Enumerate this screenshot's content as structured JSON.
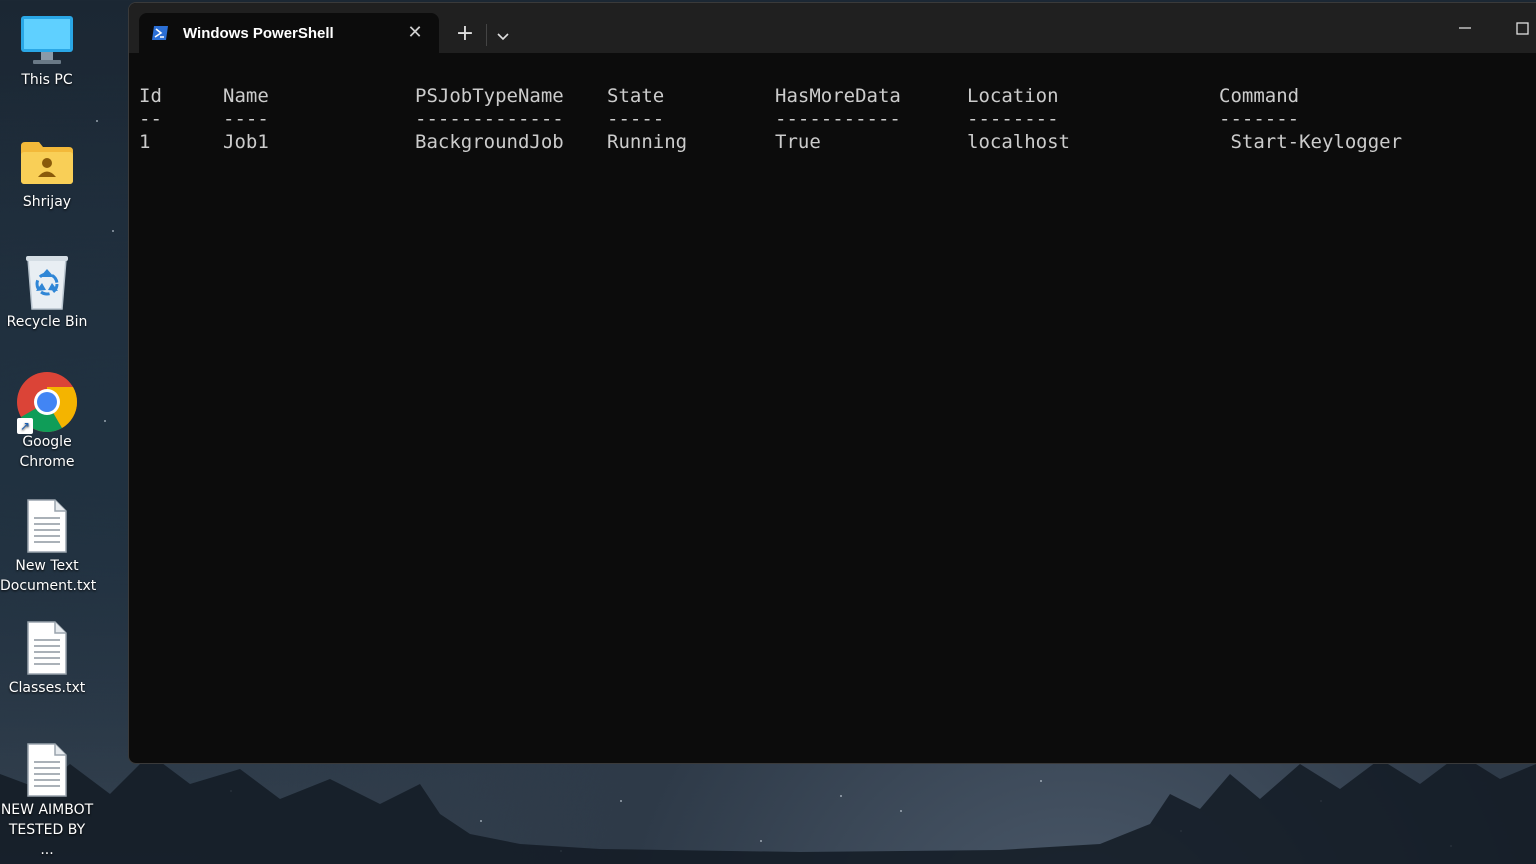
{
  "desktop": {
    "icons": [
      {
        "label": "This PC",
        "icon": "monitor-icon"
      },
      {
        "label": "Shrijay",
        "icon": "user-folder-icon"
      },
      {
        "label": "Recycle Bin",
        "icon": "recycle-bin-icon"
      },
      {
        "label": "Google Chrome",
        "icon": "chrome-icon"
      },
      {
        "label": "New Text Document.txt",
        "icon": "text-file-icon"
      },
      {
        "label": "Classes.txt",
        "icon": "text-file-icon"
      },
      {
        "label": "NEW AIMBOT TESTED BY ...",
        "icon": "text-file-icon"
      }
    ]
  },
  "window": {
    "tab_title": "Windows PowerShell",
    "close_glyph": "✕",
    "new_tab_glyph": "+"
  },
  "console": {
    "headers": [
      "Id",
      "Name",
      "PSJobTypeName",
      "State",
      "HasMoreData",
      "Location",
      "Command"
    ],
    "underlines": [
      "--",
      "----",
      "-------------",
      "-----",
      "-----------",
      "--------",
      "-------"
    ],
    "rows": [
      [
        "1",
        "Job1",
        "BackgroundJob",
        "Running",
        "True",
        "localhost",
        " Start-Keylogger"
      ]
    ]
  },
  "colors": {
    "terminal_bg": "#0c0c0c",
    "titlebar_bg": "#202020",
    "terminal_text": "#cccccc"
  }
}
